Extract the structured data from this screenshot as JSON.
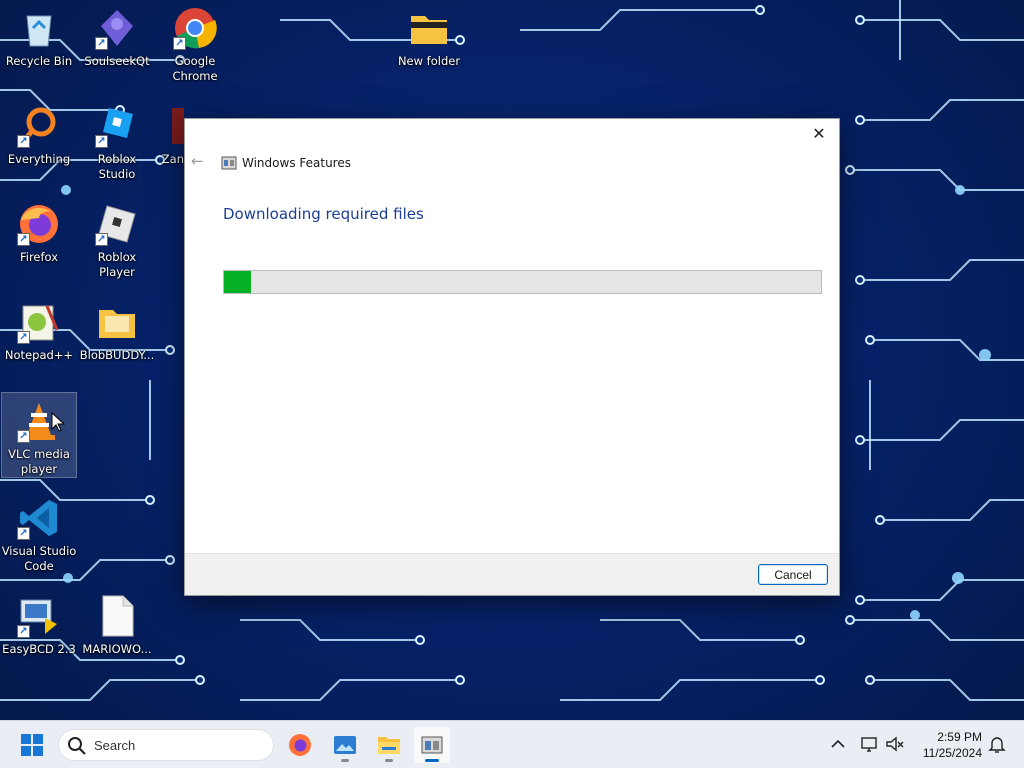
{
  "desktop": {
    "icons": [
      {
        "label": "Recycle Bin",
        "icon": "recycle-bin-icon"
      },
      {
        "label": "SoulseekQt",
        "icon": "soulseek-icon"
      },
      {
        "label": "Google Chrome",
        "icon": "chrome-icon"
      },
      {
        "label": "New folder",
        "icon": "folder-icon"
      },
      {
        "label": "Everything",
        "icon": "everything-search-icon"
      },
      {
        "label": "Roblox Studio",
        "icon": "roblox-studio-icon"
      },
      {
        "label": "Zan",
        "icon": "app-icon"
      },
      {
        "label": "Firefox",
        "icon": "firefox-icon"
      },
      {
        "label": "Roblox Player",
        "icon": "roblox-player-icon"
      },
      {
        "label": "Notepad++",
        "icon": "notepadpp-icon"
      },
      {
        "label": "BlobBUDDY...",
        "icon": "folder-icon"
      },
      {
        "label": "VLC media player",
        "icon": "vlc-icon"
      },
      {
        "label": "Visual Studio Code",
        "icon": "vscode-icon"
      },
      {
        "label": "EasyBCD 2.3",
        "icon": "easybcd-icon"
      },
      {
        "label": "MARIOWO...",
        "icon": "document-icon"
      }
    ]
  },
  "dialog": {
    "title": "Windows Features",
    "heading": "Downloading required files",
    "progress": 0.045,
    "cancel_label": "Cancel",
    "close_glyph": "✕",
    "back_glyph": "←"
  },
  "taskbar": {
    "search_placeholder": "Search",
    "time": "2:59 PM",
    "date": "11/25/2024",
    "apps": [
      "start-icon",
      "firefox-icon",
      "photos-icon",
      "file-explorer-icon",
      "windows-features-icon"
    ],
    "tray": [
      "chevron-up-icon",
      "network-icon",
      "volume-muted-icon",
      "notification-bell-icon"
    ]
  },
  "colors": {
    "accent": "#0067c0",
    "progress_fill": "#06b025",
    "heading": "#1c3f94"
  }
}
